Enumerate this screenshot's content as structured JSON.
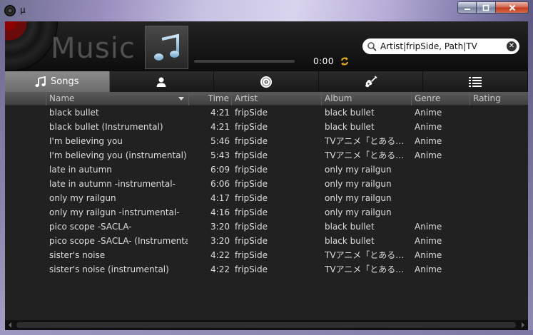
{
  "window": {
    "title": "μ"
  },
  "header": {
    "app_title": "Music",
    "time": "0:00",
    "search": {
      "value": "Artist|fripSide, Path|TV",
      "placeholder": ""
    }
  },
  "tabs": [
    {
      "label": "Songs",
      "icon": "music-note-icon",
      "active": true
    },
    {
      "label": "",
      "icon": "person-icon",
      "active": false
    },
    {
      "label": "",
      "icon": "disc-icon",
      "active": false
    },
    {
      "label": "",
      "icon": "guitar-icon",
      "active": false
    },
    {
      "label": "",
      "icon": "playlist-icon",
      "active": false
    }
  ],
  "columns": {
    "name": "Name",
    "time": "Time",
    "artist": "Artist",
    "album": "Album",
    "genre": "Genre",
    "rating": "Rating"
  },
  "songs": [
    {
      "name": "black bullet",
      "time": "4:21",
      "artist": "fripSide",
      "album": "black bullet",
      "genre": "Anime",
      "rating": ""
    },
    {
      "name": "black bullet (Instrumental)",
      "time": "4:21",
      "artist": "fripSide",
      "album": "black bullet",
      "genre": "Anime",
      "rating": ""
    },
    {
      "name": "I'm believing you",
      "time": "5:46",
      "artist": "fripSide",
      "album": "TVアニメ「とある…",
      "genre": "Anime",
      "rating": ""
    },
    {
      "name": "I'm believing you (instrumental)",
      "time": "5:43",
      "artist": "fripSide",
      "album": "TVアニメ「とある…",
      "genre": "Anime",
      "rating": ""
    },
    {
      "name": "late in autumn",
      "time": "6:09",
      "artist": "fripSide",
      "album": "only my railgun",
      "genre": "",
      "rating": ""
    },
    {
      "name": "late in autumn -instrumental-",
      "time": "6:06",
      "artist": "fripSide",
      "album": "only my railgun",
      "genre": "",
      "rating": ""
    },
    {
      "name": "only my railgun",
      "time": "4:17",
      "artist": "fripSide",
      "album": "only my railgun",
      "genre": "",
      "rating": ""
    },
    {
      "name": "only my railgun -instrumental-",
      "time": "4:16",
      "artist": "fripSide",
      "album": "only my railgun",
      "genre": "",
      "rating": ""
    },
    {
      "name": "pico scope -SACLA-",
      "time": "3:20",
      "artist": "fripSide",
      "album": "black bullet",
      "genre": "Anime",
      "rating": ""
    },
    {
      "name": "pico scope -SACLA- (Instrumental)",
      "time": "3:20",
      "artist": "fripSide",
      "album": "black bullet",
      "genre": "Anime",
      "rating": ""
    },
    {
      "name": "sister's noise",
      "time": "4:22",
      "artist": "fripSide",
      "album": "TVアニメ「とある…",
      "genre": "Anime",
      "rating": ""
    },
    {
      "name": "sister's noise (instrumental)",
      "time": "4:22",
      "artist": "fripSide",
      "album": "TVアニメ「とある…",
      "genre": "Anime",
      "rating": ""
    }
  ],
  "colors": {
    "accent_repeat": "#e8b21c",
    "active_tab": "#7a7a7a",
    "list_background": "#212121"
  }
}
